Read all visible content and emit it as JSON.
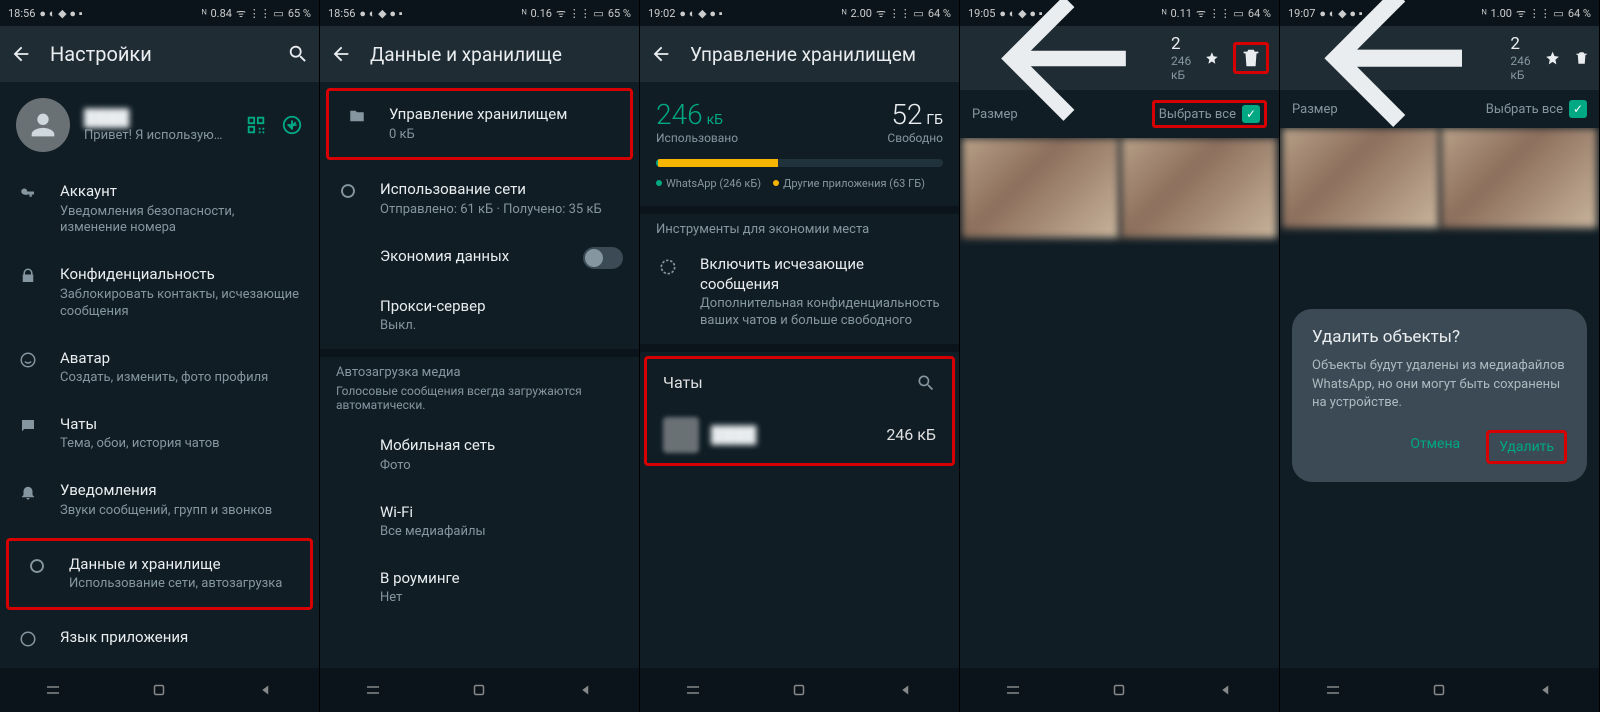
{
  "status": {
    "times": [
      "18:56",
      "18:56",
      "19:02",
      "19:05",
      "19:07"
    ],
    "net": [
      "0.84",
      "0.16",
      "2.00",
      "0.11",
      "1.00"
    ],
    "bat": [
      "65 %",
      "65 %",
      "64 %",
      "64 %",
      "64 %"
    ]
  },
  "p1": {
    "title": "Настройки",
    "profile_status": "Привет! Я использую…",
    "items": [
      {
        "t": "Аккаунт",
        "s": "Уведомления безопасности, изменение номера"
      },
      {
        "t": "Конфиденциальность",
        "s": "Заблокировать контакты, исчезающие сообщения"
      },
      {
        "t": "Аватар",
        "s": "Создать, изменить, фото профиля"
      },
      {
        "t": "Чаты",
        "s": "Тема, обои, история чатов"
      },
      {
        "t": "Уведомления",
        "s": "Звуки сообщений, групп и звонков"
      },
      {
        "t": "Данные и хранилище",
        "s": "Использование сети, автозагрузка"
      },
      {
        "t": "Язык приложения",
        "s": ""
      }
    ]
  },
  "p2": {
    "title": "Данные и хранилище",
    "items": [
      {
        "t": "Управление хранилищем",
        "s": "0 кБ"
      },
      {
        "t": "Использование сети",
        "s": "Отправлено: 61 кБ · Получено: 35 кБ"
      },
      {
        "t": "Экономия данных",
        "s": ""
      },
      {
        "t": "Прокси-сервер",
        "s": "Выкл."
      }
    ],
    "section": "Автозагрузка медиа",
    "section_sub": "Голосовые сообщения всегда загружаются автоматически.",
    "auto": [
      {
        "t": "Мобильная сеть",
        "s": "Фото"
      },
      {
        "t": "Wi-Fi",
        "s": "Все медиафайлы"
      },
      {
        "t": "В роуминге",
        "s": "Нет"
      }
    ]
  },
  "p3": {
    "title": "Управление хранилищем",
    "used_n": "246",
    "used_u": "кБ",
    "used_l": "Использовано",
    "free_n": "52",
    "free_u": "ГБ",
    "free_l": "Свободно",
    "leg1": "WhatsApp (246 кБ)",
    "leg2": "Другие приложения (63 ГБ)",
    "tools": "Инструменты для экономии места",
    "dm_t": "Включить исчезающие сообщения",
    "dm_s": "Дополнительная конфиденциальность ваших чатов и больше свободного",
    "chats": "Чаты",
    "chat_size": "246 кБ"
  },
  "p4": {
    "title": "2",
    "size": "246 кБ",
    "size_label": "Размер",
    "select_all": "Выбрать все"
  },
  "p5": {
    "title": "2",
    "size": "246 кБ",
    "size_label": "Размер",
    "select_all": "Выбрать все",
    "dlg_t": "Удалить объекты?",
    "dlg_b": "Объекты будут удалены из медиафайлов WhatsApp, но они могут быть сохранены на устройстве.",
    "cancel": "Отмена",
    "delete": "Удалить"
  }
}
